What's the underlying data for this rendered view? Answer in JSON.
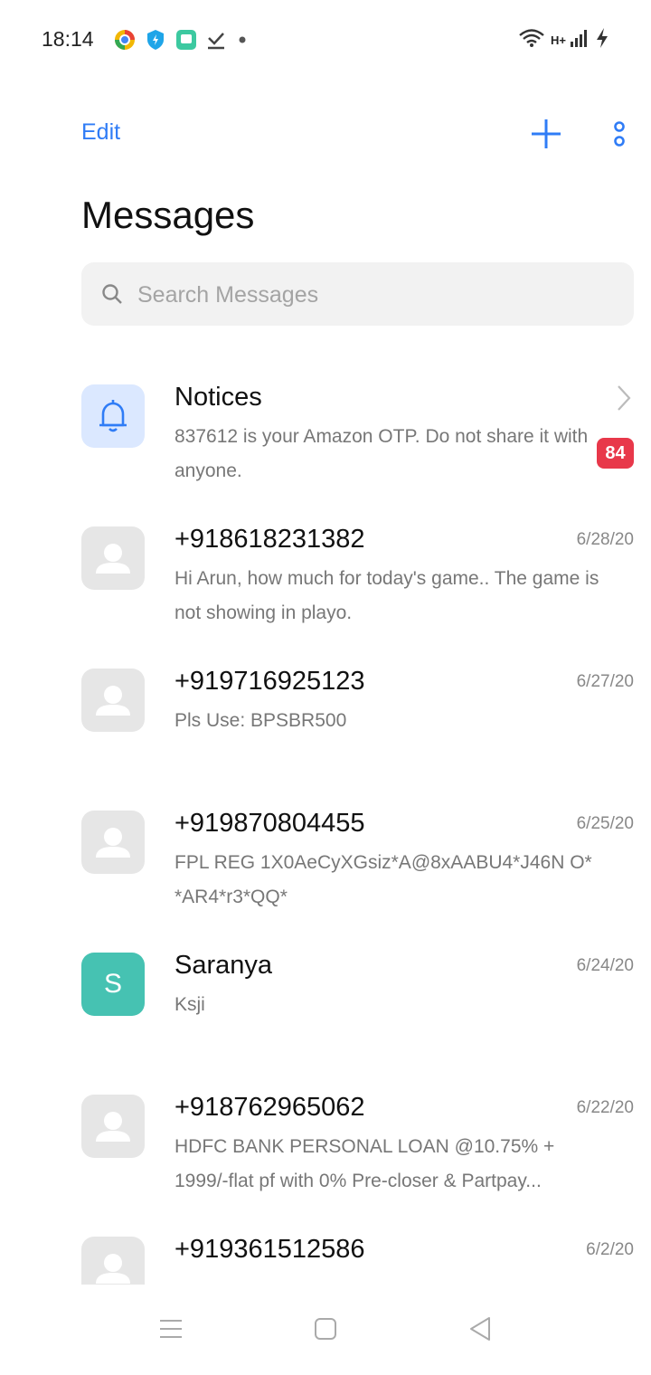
{
  "status_bar": {
    "time": "18:14",
    "network": "H+"
  },
  "header": {
    "edit_label": "Edit",
    "title": "Messages"
  },
  "search": {
    "placeholder": "Search Messages"
  },
  "messages": [
    {
      "name": "Notices",
      "preview": "837612 is your Amazon OTP. Do not share it with anyone.",
      "badge": "84",
      "avatar": "bell-icon"
    },
    {
      "name": "+918618231382",
      "date": "6/28/20",
      "preview": "Hi Arun, how much for today's game.. The game is not showing in playo.",
      "avatar": "person-icon"
    },
    {
      "name": "+919716925123",
      "date": "6/27/20",
      "preview": "Pls Use: BPSBR500",
      "avatar": "person-icon"
    },
    {
      "name": "+919870804455",
      "date": "6/25/20",
      "preview": "FPL REG 1X0AeCyXGsiz*A@8xAABU4*J46N O**AR4*r3*QQ*",
      "avatar": "person-icon"
    },
    {
      "name": "Saranya",
      "date": "6/24/20",
      "preview": "Ksji",
      "avatar_letter": "S",
      "avatar_color": "#46c2b2"
    },
    {
      "name": "+918762965062",
      "date": "6/22/20",
      "preview": "HDFC BANK PERSONAL LOAN @10.75% + 1999/-flat pf with 0% Pre-closer & Partpay...",
      "avatar": "person-icon"
    },
    {
      "name": "+919361512586",
      "date": "6/2/20",
      "preview": "",
      "avatar": "person-icon"
    }
  ],
  "colors": {
    "accent": "#2f7cf6",
    "badge": "#e8384a",
    "avatar_grey": "#e6e6e6"
  }
}
